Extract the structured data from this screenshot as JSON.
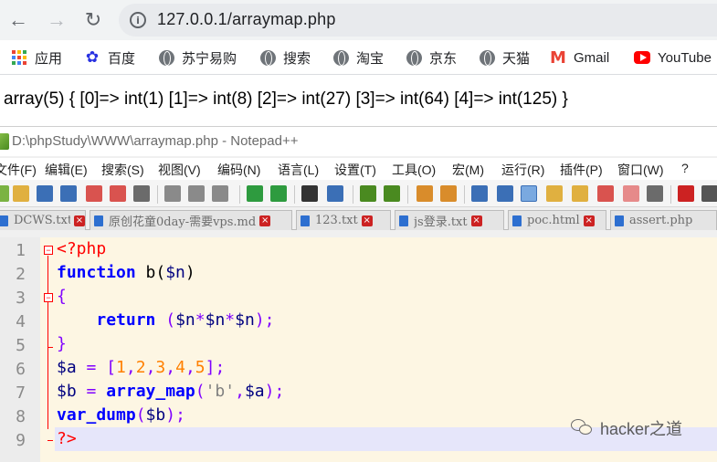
{
  "browser": {
    "url": "127.0.0.1/arraymap.php",
    "bookmarks": [
      {
        "label": "应用",
        "icon": "apps-grid-icon"
      },
      {
        "label": "百度",
        "icon": "baidu-icon"
      },
      {
        "label": "苏宁易购",
        "icon": "globe-icon"
      },
      {
        "label": "搜索",
        "icon": "globe-icon"
      },
      {
        "label": "淘宝",
        "icon": "globe-icon"
      },
      {
        "label": "京东",
        "icon": "globe-icon"
      },
      {
        "label": "天猫",
        "icon": "globe-icon"
      },
      {
        "label": "Gmail",
        "icon": "gmail-icon"
      },
      {
        "label": "YouTube",
        "icon": "youtube-icon"
      }
    ]
  },
  "page": {
    "output": "array(5) { [0]=> int(1) [1]=> int(8) [2]=> int(27) [3]=> int(64) [4]=> int(125) }"
  },
  "notepad": {
    "title": "D:\\phpStudy\\WWW\\arraymap.php - Notepad++",
    "menu": [
      "文件(F)",
      "编辑(E)",
      "搜索(S)",
      "视图(V)",
      "编码(N)",
      "语言(L)",
      "设置(T)",
      "工具(O)",
      "宏(M)",
      "运行(R)",
      "插件(P)",
      "窗口(W)",
      "?"
    ],
    "tabs": [
      "DCWS.txt",
      "原创花童0day-需要vps.md",
      "123.txt",
      "js登录.txt",
      "poc.html",
      "assert.php"
    ],
    "line_numbers": [
      "1",
      "2",
      "3",
      "4",
      "5",
      "6",
      "7",
      "8",
      "9"
    ],
    "code": {
      "l1_open": "<?php",
      "l2_kw": "function",
      "l2_rest": " b(",
      "l2_var": "$n",
      "l2_close": ")",
      "l3": "{",
      "l4_indent": "    ",
      "l4_kw": "return",
      "l4_p1": " (",
      "l4_v1": "$n",
      "l4_o1": "*",
      "l4_v2": "$n",
      "l4_o2": "*",
      "l4_v3": "$n",
      "l4_p2": ");",
      "l5": "}",
      "l6_var": "$a",
      "l6_eq": " = [",
      "l6_n1": "1",
      "l6_c1": ",",
      "l6_n2": "2",
      "l6_c2": ",",
      "l6_n3": "3",
      "l6_c3": ",",
      "l6_n4": "4",
      "l6_c4": ",",
      "l6_n5": "5",
      "l6_end": "];",
      "l7_var": "$b",
      "l7_eq": " = ",
      "l7_fn": "array_map",
      "l7_p1": "(",
      "l7_str": "'b'",
      "l7_comma": ",",
      "l7_var2": "$a",
      "l7_p2": ");",
      "l8_fn": "var_dump",
      "l8_p1": "(",
      "l8_var": "$b",
      "l8_p2": ");",
      "l9_close": "?>"
    }
  },
  "watermark": "hacker之道",
  "colors": {
    "keyword": "#0000ff",
    "variable": "#000080",
    "number": "#ff8000",
    "string": "#808080",
    "operator": "#8000ff",
    "php_tag": "#ff0000",
    "editor_bg": "#fdf6e3",
    "current_line": "#e6e6fa"
  }
}
